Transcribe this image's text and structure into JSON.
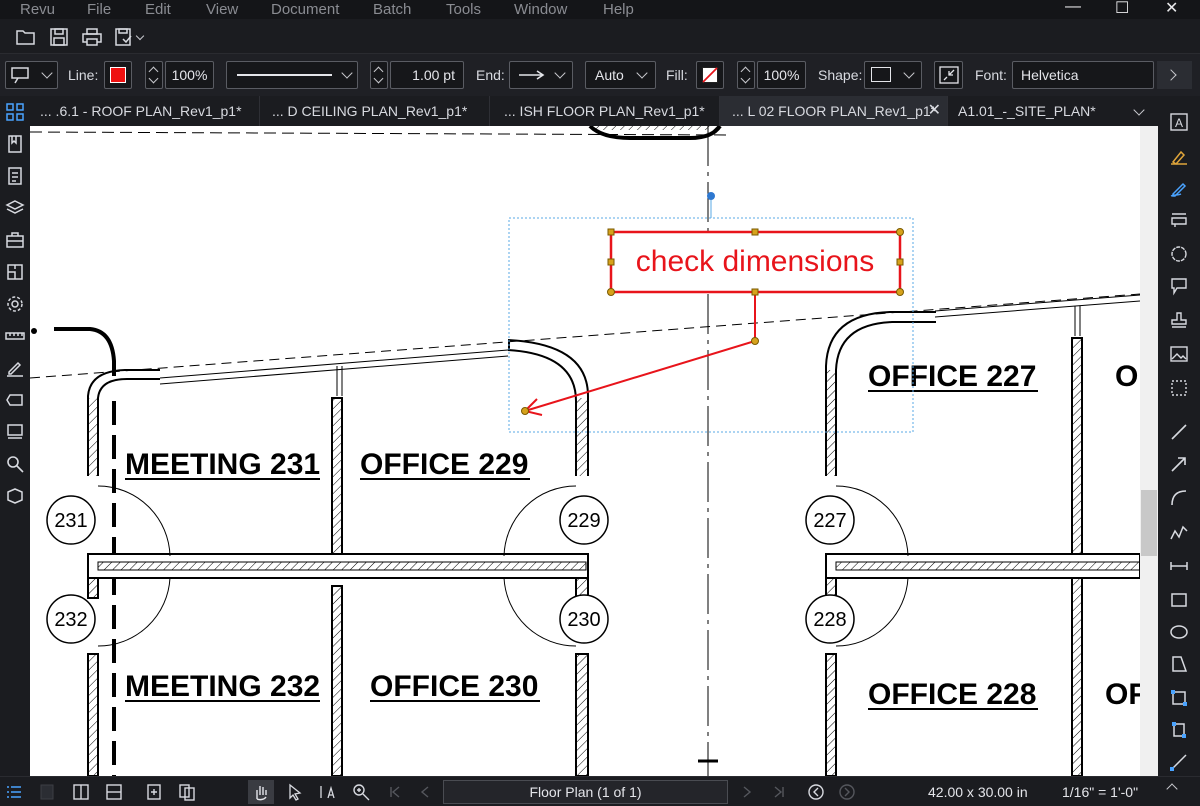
{
  "menu": [
    "Revu",
    "File",
    "Edit",
    "View",
    "Document",
    "Batch",
    "Tools",
    "Window",
    "Help"
  ],
  "window_controls": {
    "minimize": "—",
    "maximize": "☐",
    "close": "✕"
  },
  "properties": {
    "line_label": "Line:",
    "line_color": "#ee1111",
    "line_opacity": "100%",
    "line_width": "1.00 pt",
    "end_label": "End:",
    "end_style": "Auto",
    "fill_label": "Fill:",
    "fill_opacity": "100%",
    "shape_label": "Shape:",
    "font_label": "Font:",
    "font_value": "Helvetica"
  },
  "tabs": [
    {
      "label": "... .6.1 - ROOF PLAN_Rev1_p1*"
    },
    {
      "label": "... D CEILING PLAN_Rev1_p1*"
    },
    {
      "label": "... ISH FLOOR PLAN_Rev1_p1*"
    },
    {
      "label": "... L 02 FLOOR PLAN_Rev1_p1*",
      "active": true
    },
    {
      "label": "A1.01_-_SITE_PLAN*"
    }
  ],
  "drawing": {
    "callout_text": "check dimensions",
    "callout_color": "#e8141b",
    "rooms": [
      {
        "label": "MEETING   231"
      },
      {
        "label": "OFFICE   229"
      },
      {
        "label": "OFFICE   227"
      },
      {
        "label": "MEETING   232"
      },
      {
        "label": "OFFICE   230"
      },
      {
        "label": "OFFICE   228"
      },
      {
        "label": "O"
      },
      {
        "label": "OF"
      }
    ],
    "door_tags": [
      "231",
      "229",
      "227",
      "232",
      "230",
      "228"
    ]
  },
  "status": {
    "page": "Floor Plan (1 of 1)",
    "page_size": "42.00 x 30.00 in",
    "scale": "1/16\" = 1'-0\""
  }
}
